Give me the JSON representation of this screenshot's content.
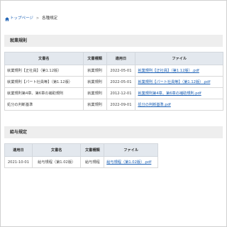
{
  "breadcrumb": {
    "home_label": "トップページ",
    "separator": ">",
    "current": "各種規定"
  },
  "sections": [
    {
      "title": "就業規則",
      "headers": [
        "文書名",
        "文書種類",
        "適用日",
        "ファイル"
      ],
      "rows": [
        {
          "name": "就業規則【正社員】（第1.12版）",
          "type": "就業規則",
          "date": "2022-05-01",
          "file": "就業規則【正社員】（第1.12版）.pdf"
        },
        {
          "name": "就業規則【パート社員等】（第1.12版）",
          "type": "就業規則",
          "date": "2022-05-01",
          "file": "就業規則【パート社員等】（第1.12版）.pdf"
        },
        {
          "name": "就業規則第4章、第6章の補助規則",
          "type": "就業規則",
          "date": "2012-12-01",
          "file": "就業規則第4章、第6章の補助規則.pdf"
        },
        {
          "name": "処分の判断基準",
          "type": "就業規則",
          "date": "2022-09-01",
          "file": "処分の判断基準.pdf"
        }
      ]
    },
    {
      "title": "給与規定",
      "headers": [
        "適用日",
        "文書名",
        "文書種類",
        "ファイル"
      ],
      "rows": [
        {
          "date": "2021-10-01",
          "name": "給与規程（第1.02版）",
          "type": "給与規程",
          "file": "給与規程（第1.02版）.pdf"
        }
      ]
    }
  ],
  "colors": {
    "link": "#1a5fb4",
    "section_header_bg": "#eeeeee",
    "table_header_bg": "#e3e8ee"
  }
}
